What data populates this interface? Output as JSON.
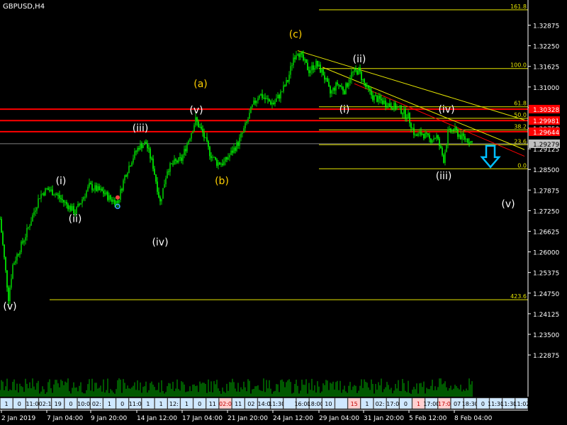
{
  "symbol_label": "GBPUSD,H4",
  "colors": {
    "background": "#000000",
    "up": "#00c800",
    "down": "#00ff00",
    "grid": "#ffffff",
    "fib": "#e6e600",
    "red_line": "#ff0000",
    "price_tag": "#ff0000",
    "current_tag": "#c0c0c0",
    "arrow": "#00bfff",
    "wave_yellow": "#ffd000",
    "wave_white": "#ffffff"
  },
  "chart_data": {
    "type": "candlestick",
    "ylim": [
      1.2161,
      1.3353
    ],
    "y_ticks": [
      "1.32875",
      "1.32250",
      "1.31625",
      "1.31000",
      "1.30375",
      "1.29750",
      "1.29125",
      "1.28500",
      "1.27875",
      "1.27250",
      "1.26625",
      "1.26000",
      "1.25375",
      "1.24750",
      "1.24125",
      "1.23500",
      "1.22875"
    ],
    "x_ticks": [
      "2 Jan 2019",
      "7 Jan 04:00",
      "9 Jan 20:00",
      "14 Jan 12:00",
      "17 Jan 04:00",
      "21 Jan 20:00",
      "24 Jan 12:00",
      "29 Jan 04:00",
      "31 Jan 20:00",
      "5 Feb 12:00",
      "8 Feb 04:00"
    ],
    "price_path": [
      {
        "t": 0,
        "p": 1.27
      },
      {
        "t": 6,
        "p": 1.258
      },
      {
        "t": 12,
        "p": 1.246
      },
      {
        "t": 18,
        "p": 1.256
      },
      {
        "t": 26,
        "p": 1.26
      },
      {
        "t": 36,
        "p": 1.265
      },
      {
        "t": 46,
        "p": 1.271
      },
      {
        "t": 56,
        "p": 1.277
      },
      {
        "t": 66,
        "p": 1.279
      },
      {
        "t": 76,
        "p": 1.278
      },
      {
        "t": 86,
        "p": 1.276
      },
      {
        "t": 96,
        "p": 1.274
      },
      {
        "t": 106,
        "p": 1.272
      },
      {
        "t": 116,
        "p": 1.276
      },
      {
        "t": 126,
        "p": 1.28
      },
      {
        "t": 136,
        "p": 1.279
      },
      {
        "t": 146,
        "p": 1.278
      },
      {
        "t": 156,
        "p": 1.276
      },
      {
        "t": 166,
        "p": 1.275
      },
      {
        "t": 176,
        "p": 1.283
      },
      {
        "t": 186,
        "p": 1.288
      },
      {
        "t": 196,
        "p": 1.292
      },
      {
        "t": 206,
        "p": 1.293
      },
      {
        "t": 216,
        "p": 1.286
      },
      {
        "t": 226,
        "p": 1.275
      },
      {
        "t": 236,
        "p": 1.285
      },
      {
        "t": 246,
        "p": 1.287
      },
      {
        "t": 256,
        "p": 1.288
      },
      {
        "t": 266,
        "p": 1.294
      },
      {
        "t": 276,
        "p": 1.3
      },
      {
        "t": 286,
        "p": 1.296
      },
      {
        "t": 296,
        "p": 1.29
      },
      {
        "t": 306,
        "p": 1.287
      },
      {
        "t": 316,
        "p": 1.287
      },
      {
        "t": 326,
        "p": 1.29
      },
      {
        "t": 336,
        "p": 1.293
      },
      {
        "t": 346,
        "p": 1.298
      },
      {
        "t": 356,
        "p": 1.304
      },
      {
        "t": 366,
        "p": 1.308
      },
      {
        "t": 376,
        "p": 1.306
      },
      {
        "t": 386,
        "p": 1.305
      },
      {
        "t": 396,
        "p": 1.308
      },
      {
        "t": 406,
        "p": 1.312
      },
      {
        "t": 414,
        "p": 1.319
      },
      {
        "t": 420,
        "p": 1.321
      },
      {
        "t": 428,
        "p": 1.318
      },
      {
        "t": 436,
        "p": 1.315
      },
      {
        "t": 446,
        "p": 1.317
      },
      {
        "t": 456,
        "p": 1.314
      },
      {
        "t": 466,
        "p": 1.308
      },
      {
        "t": 476,
        "p": 1.311
      },
      {
        "t": 486,
        "p": 1.309
      },
      {
        "t": 496,
        "p": 1.314
      },
      {
        "t": 506,
        "p": 1.315
      },
      {
        "t": 516,
        "p": 1.31
      },
      {
        "t": 526,
        "p": 1.307
      },
      {
        "t": 536,
        "p": 1.306
      },
      {
        "t": 546,
        "p": 1.305
      },
      {
        "t": 556,
        "p": 1.304
      },
      {
        "t": 566,
        "p": 1.303
      },
      {
        "t": 576,
        "p": 1.301
      },
      {
        "t": 586,
        "p": 1.295
      },
      {
        "t": 596,
        "p": 1.296
      },
      {
        "t": 606,
        "p": 1.294
      },
      {
        "t": 616,
        "p": 1.295
      },
      {
        "t": 626,
        "p": 1.288
      },
      {
        "t": 632,
        "p": 1.296
      },
      {
        "t": 640,
        "p": 1.297
      },
      {
        "t": 650,
        "p": 1.295
      },
      {
        "t": 660,
        "p": 1.294
      },
      {
        "t": 668,
        "p": 1.293
      }
    ],
    "horizontal_levels": [
      {
        "name": "fib-161.8",
        "label": "161.8",
        "price": 1.3334,
        "color": "fib",
        "x1": 450
      },
      {
        "name": "fib-100",
        "label": "100.0",
        "price": 1.3156,
        "color": "fib",
        "x1": 450
      },
      {
        "name": "fib-61.8",
        "label": "61.8",
        "price": 1.304,
        "color": "fib",
        "x1": 450
      },
      {
        "name": "fib-50",
        "label": "50.0",
        "price": 1.3005,
        "color": "fib",
        "x1": 450
      },
      {
        "name": "fib-38.2",
        "label": "38.2",
        "price": 1.297,
        "color": "fib",
        "x1": 450
      },
      {
        "name": "fib-23.6",
        "label": "23.6",
        "price": 1.2925,
        "color": "fib",
        "x1": 450
      },
      {
        "name": "fib-0",
        "label": "0.0",
        "price": 1.2852,
        "color": "fib",
        "x1": 450
      },
      {
        "name": "fib-423.6",
        "label": "423.6",
        "price": 1.2455,
        "color": "fib",
        "x1": 70
      }
    ],
    "red_levels": [
      {
        "label": "1.30328",
        "price": 1.30328
      },
      {
        "label": "1.29981",
        "price": 1.29981
      },
      {
        "label": "1.29644",
        "price": 1.29644
      }
    ],
    "current_price": {
      "label": "1.29279",
      "price": 1.29279
    },
    "trend_lines": [
      {
        "name": "trendline-upper",
        "t1": 420,
        "p1": 1.321,
        "t2": 740,
        "p2": 1.3
      },
      {
        "name": "trendline-middle",
        "t1": 455,
        "p1": 1.316,
        "t2": 740,
        "p2": 1.291
      },
      {
        "name": "trendline-channel",
        "t1": 500,
        "p1": 1.311,
        "t2": 740,
        "p2": 1.289
      }
    ],
    "wave_labels": [
      {
        "text": "(v)",
        "t": 14,
        "p": 1.2425,
        "color": "wave_white"
      },
      {
        "text": "(i)",
        "t": 86,
        "p": 1.2805,
        "color": "wave_white"
      },
      {
        "text": "(ii)",
        "t": 106,
        "p": 1.269,
        "color": "wave_white"
      },
      {
        "text": "(iii)",
        "t": 198,
        "p": 1.2965,
        "color": "wave_white"
      },
      {
        "text": "(iv)",
        "t": 226,
        "p": 1.262,
        "color": "wave_white"
      },
      {
        "text": "(a)",
        "t": 283,
        "p": 1.31,
        "color": "wave_yellow"
      },
      {
        "text": "(v)",
        "t": 277,
        "p": 1.302,
        "color": "wave_white"
      },
      {
        "text": "(b)",
        "t": 313,
        "p": 1.2805,
        "color": "wave_yellow"
      },
      {
        "text": "(c)",
        "t": 417,
        "p": 1.325,
        "color": "wave_yellow"
      },
      {
        "text": "(ii)",
        "t": 507,
        "p": 1.3175,
        "color": "wave_white"
      },
      {
        "text": "(i)",
        "t": 486,
        "p": 1.3022,
        "color": "wave_white"
      },
      {
        "text": "(iv)",
        "t": 630,
        "p": 1.3022,
        "color": "wave_white"
      },
      {
        "text": "(iii)",
        "t": 626,
        "p": 1.282,
        "color": "wave_white"
      },
      {
        "text": "(v)",
        "t": 717,
        "p": 1.2735,
        "color": "wave_white"
      }
    ],
    "volume_seed": 7
  },
  "bottom_boxes": [
    "1",
    "0",
    "11:0",
    "02:1",
    "19",
    "0",
    "10:0",
    "02:",
    "1",
    "0",
    "11:0",
    "1",
    "1",
    "12:",
    "1",
    "0",
    "11",
    "02:0",
    "11",
    "02",
    "14:0",
    "11:30",
    "",
    "16:00",
    "18:00",
    "10",
    "",
    "15",
    "1",
    "02:",
    "17:0",
    "0",
    "1",
    "17:00",
    "17:0",
    "07",
    "18:30",
    "0",
    "11:30",
    "11:30",
    "11:02"
  ]
}
